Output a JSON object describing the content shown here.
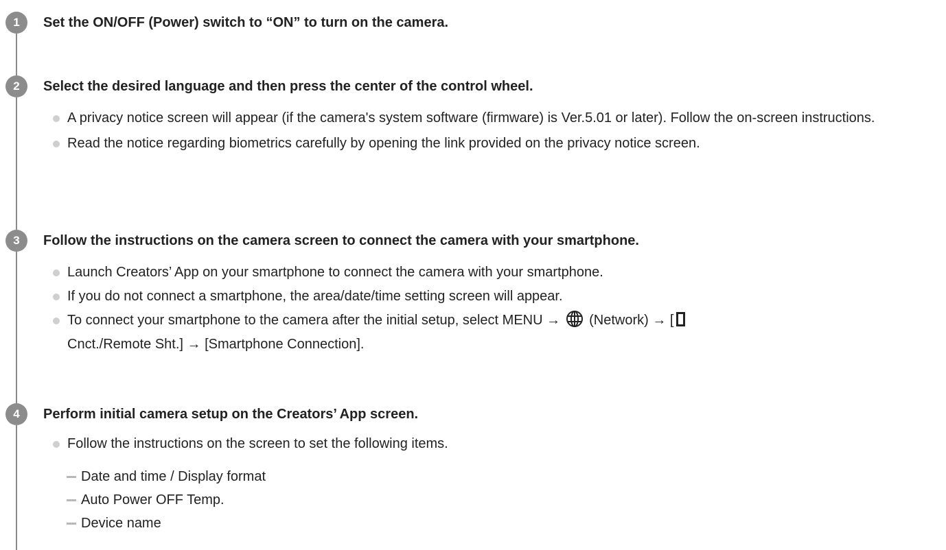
{
  "steps": [
    {
      "number": "1",
      "title": "Set the ON/OFF (Power) switch to “ON” to turn on the camera.",
      "bullets": []
    },
    {
      "number": "2",
      "title": "Select the desired language and then press the center of the control wheel.",
      "bullets": [
        "A privacy notice screen will appear (if the camera's system software (firmware) is Ver.5.01 or later). Follow the on-screen instructions.",
        "Read the notice regarding biometrics carefully by opening the link provided on the privacy notice screen."
      ]
    },
    {
      "number": "3",
      "title": "Follow the instructions on the camera screen to connect the camera with your smartphone.",
      "bullets": [
        "Launch Creators’ App on your smartphone to connect the camera with your smartphone.",
        "If you do not connect a smartphone, the area/date/time setting screen will appear."
      ],
      "menu_bullet": {
        "part1": "To connect your smartphone to the camera after the initial setup, select MENU →",
        "part2": "(Network) → [",
        "part3": "Cnct./Remote Sht.] → [Smartphone Connection].",
        "icons": [
          "globe-icon",
          "smartphone-icon"
        ]
      }
    },
    {
      "number": "4",
      "title": "Perform initial camera setup on the Creators’ App screen.",
      "bullets": [
        "Follow the instructions on the screen to set the following items."
      ],
      "sub_items": [
        "Date and time / Display format",
        "Auto Power OFF Temp.",
        "Device name"
      ]
    }
  ]
}
